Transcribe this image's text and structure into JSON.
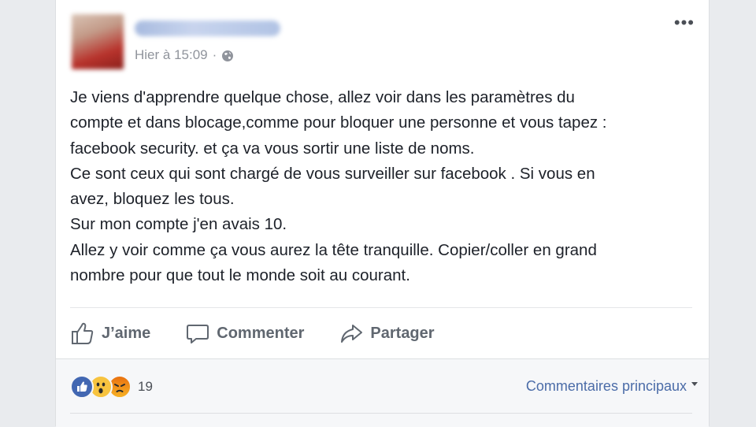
{
  "post": {
    "author_name": "",
    "timestamp": "Hier à 15:09",
    "separator": "·",
    "privacy_icon": "globe-icon",
    "more_icon": "more-options-icon",
    "more_glyph": "•••",
    "text_lines": [
      "Je viens d'apprendre quelque chose, allez voir dans les paramètres du",
      "compte et dans blocage,comme pour bloquer une personne et vous tapez :",
      "facebook security. et ça va vous sortir une liste de noms.",
      "Ce sont ceux qui sont chargé de vous surveiller sur facebook . Si vous en",
      "avez, bloquez les tous.",
      "Sur mon compte j'en avais 10.",
      "Allez y voir comme ça vous aurez la tête tranquille. Copier/coller en grand",
      "nombre pour que tout le monde soit au courant."
    ]
  },
  "actions": {
    "like_label": "J’aime",
    "comment_label": "Commenter",
    "share_label": "Partager"
  },
  "reactions": {
    "icons": [
      "like-reaction-icon",
      "wow-reaction-icon",
      "angry-reaction-icon"
    ],
    "count": "19"
  },
  "comments": {
    "sort_label": "Commentaires principaux"
  },
  "colors": {
    "background": "#e9ebee",
    "card": "#ffffff",
    "text": "#1d2129",
    "meta": "#90949c",
    "action": "#606770",
    "link": "#4b6ca8",
    "like_blue": "#4267b2"
  }
}
